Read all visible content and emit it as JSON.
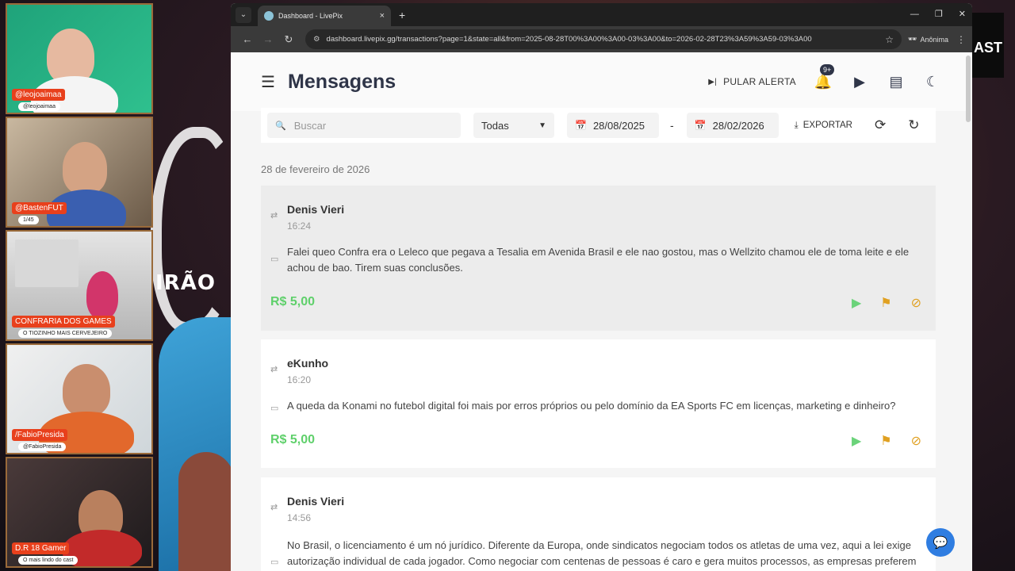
{
  "webcams": [
    {
      "name": "@leojoaimaa",
      "sub": "@leojoaimaa"
    },
    {
      "name": "@BastenFUT",
      "sub": "1/45"
    },
    {
      "name": "CONFRARIA DOS GAMES",
      "sub": "O TIOZINHO MAIS CERVEJEIRO"
    },
    {
      "name": "/FabioPresida",
      "sub": "@FabioPresida"
    },
    {
      "name": "D.R 18 Gamer",
      "sub": "O mais lindo do cast"
    }
  ],
  "stream": {
    "side_text": "IRÃO",
    "right_tag": "AST"
  },
  "browser": {
    "tab_title": "Dashboard - LivePix",
    "url": "dashboard.livepix.gg/transactions?page=1&state=all&from=2025-08-28T00%3A00%3A00-03%3A00&to=2026-02-28T23%3A59%3A59-03%3A00",
    "profile": "Anônima"
  },
  "header": {
    "title": "Mensagens",
    "skip_alert": "PULAR ALERTA",
    "notifications_badge": "9+"
  },
  "filters": {
    "search_placeholder": "Buscar",
    "status_selected": "Todas",
    "date_from": "28/08/2025",
    "date_to": "28/02/2026",
    "separator": "-",
    "export_label": "EXPORTAR"
  },
  "date_group": "28 de fevereiro de 2026",
  "transactions": [
    {
      "name": "Denis Vieri",
      "time": "16:24",
      "message": "Falei queo Confra era o Leleco que pegava a Tesalia em Avenida Brasil e ele nao gostou, mas o Wellzito chamou ele de toma leite e ele achou de bao. Tirem suas conclusões.",
      "amount": "R$ 5,00"
    },
    {
      "name": "eKunho",
      "time": "16:20",
      "message": "A queda da Konami no futebol digital foi mais por erros próprios ou pelo domínio da EA Sports FC em licenças, marketing e dinheiro?",
      "amount": "R$ 5,00"
    },
    {
      "name": "Denis Vieri",
      "time": "14:56",
      "message": "No Brasil, o licenciamento é um nó jurídico. Diferente da Europa, onde sindicatos negociam todos os atletas de uma vez, aqui a lei exige autorização individual de cada jogador. Como negociar com centenas de pessoas é caro e gera muitos processos, as empresas preferem",
      "amount": ""
    }
  ],
  "colors": {
    "amount": "#5fd06b",
    "play": "#6bd37a",
    "flag": "#e0a020",
    "accent": "#2f7de1"
  }
}
